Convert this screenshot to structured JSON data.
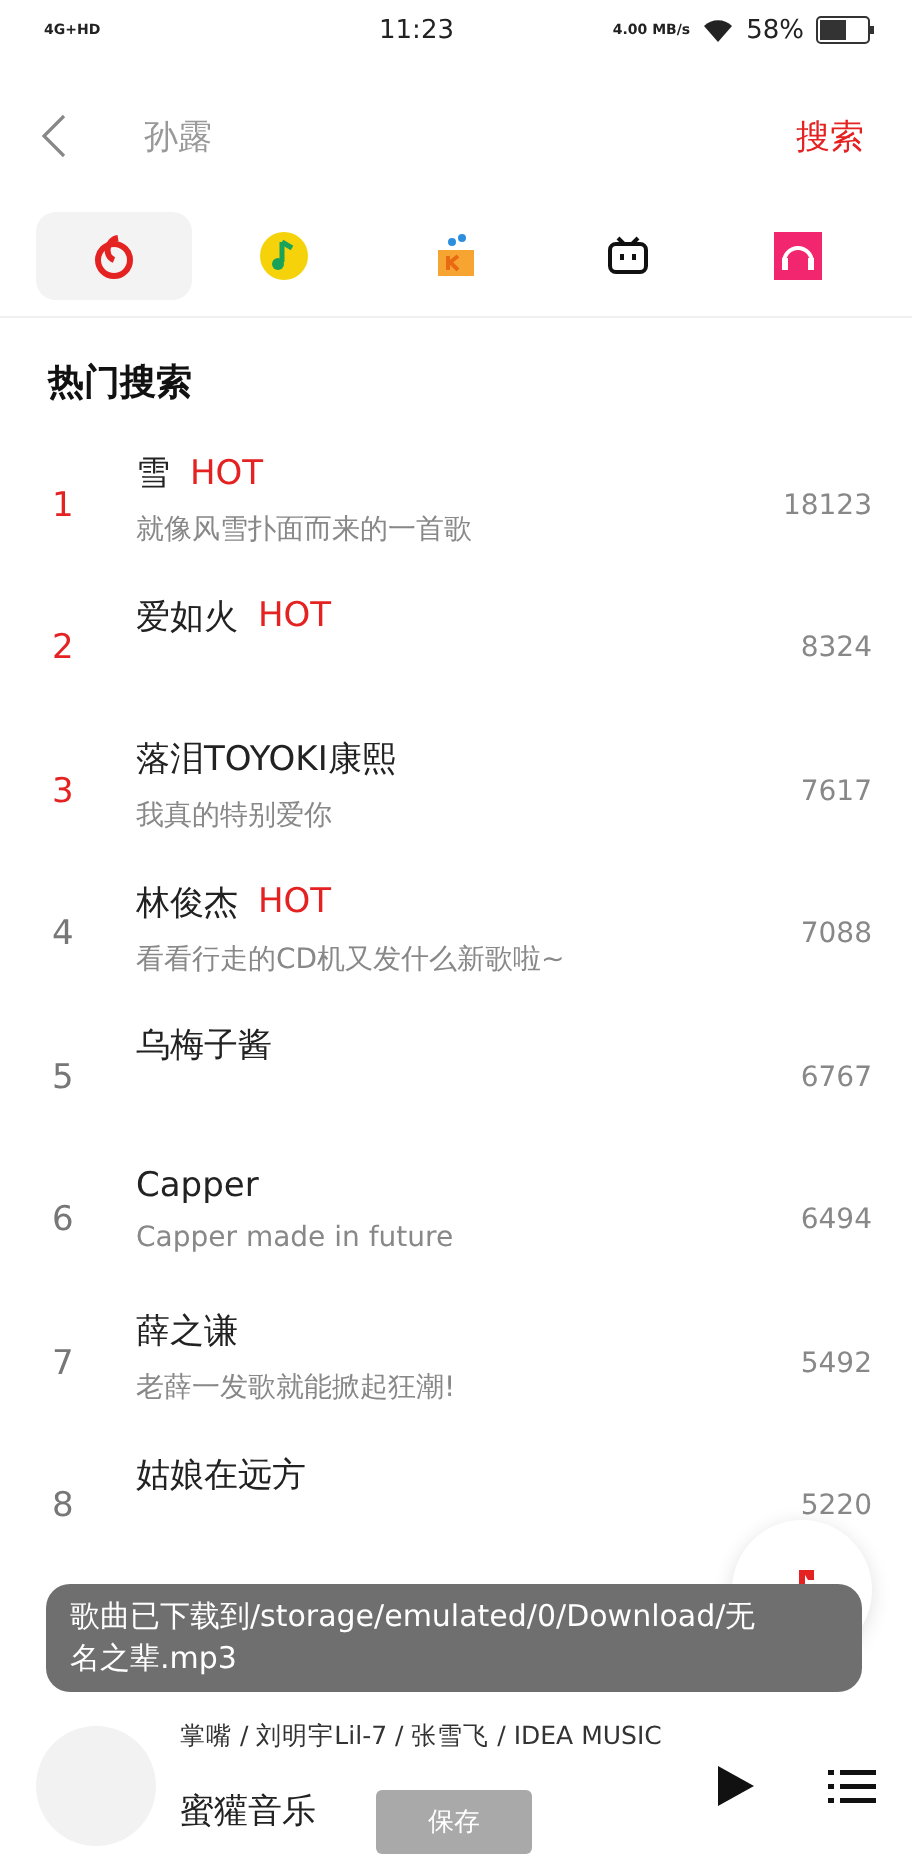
{
  "status_bar": {
    "carrier": "4G+HD",
    "time": "11:23",
    "speed": "4.00 MB/s",
    "battery": "58%"
  },
  "header": {
    "query": "孙露",
    "search_button": "搜索"
  },
  "sources": [
    {
      "kind": "netease",
      "selected": true
    },
    {
      "kind": "qq",
      "selected": false
    },
    {
      "kind": "kuwo",
      "selected": false
    },
    {
      "kind": "bili",
      "selected": false
    },
    {
      "kind": "migu",
      "selected": false
    }
  ],
  "hot_search": {
    "title": "热门搜索",
    "items": [
      {
        "rank": "1",
        "top": true,
        "title": "雪",
        "hot": "HOT",
        "subtitle": "就像风雪扑面而来的一首歌",
        "count": "18123"
      },
      {
        "rank": "2",
        "top": true,
        "title": "爱如火",
        "hot": "HOT",
        "count": "8324"
      },
      {
        "rank": "3",
        "top": true,
        "title": "落泪TOYOKI康熙",
        "subtitle": "我真的特别爱你",
        "count": "7617"
      },
      {
        "rank": "4",
        "top": false,
        "title": "林俊杰",
        "hot": "HOT",
        "subtitle": "看看行走的CD机又发什么新歌啦~",
        "count": "7088"
      },
      {
        "rank": "5",
        "top": false,
        "title": "乌梅子酱",
        "count": "6767"
      },
      {
        "rank": "6",
        "top": false,
        "title": "Capper",
        "subtitle": "Capper made in future",
        "count": "6494"
      },
      {
        "rank": "7",
        "top": false,
        "title": "薛之谦",
        "subtitle": "老薛一发歌就能掀起狂潮!",
        "count": "5492"
      },
      {
        "rank": "8",
        "top": false,
        "title": "姑娘在远方",
        "count": "5220"
      }
    ]
  },
  "toast": "歌曲已下载到/storage/emulated/0/Download/无名之辈.mp3",
  "player": {
    "artists": "掌嘴 / 刘明宇Lil-7 / 张雪飞 / IDEA MUSIC",
    "title": "蜜獾音乐",
    "save_button": {
      "label": "保存",
      "disabled": true
    }
  }
}
